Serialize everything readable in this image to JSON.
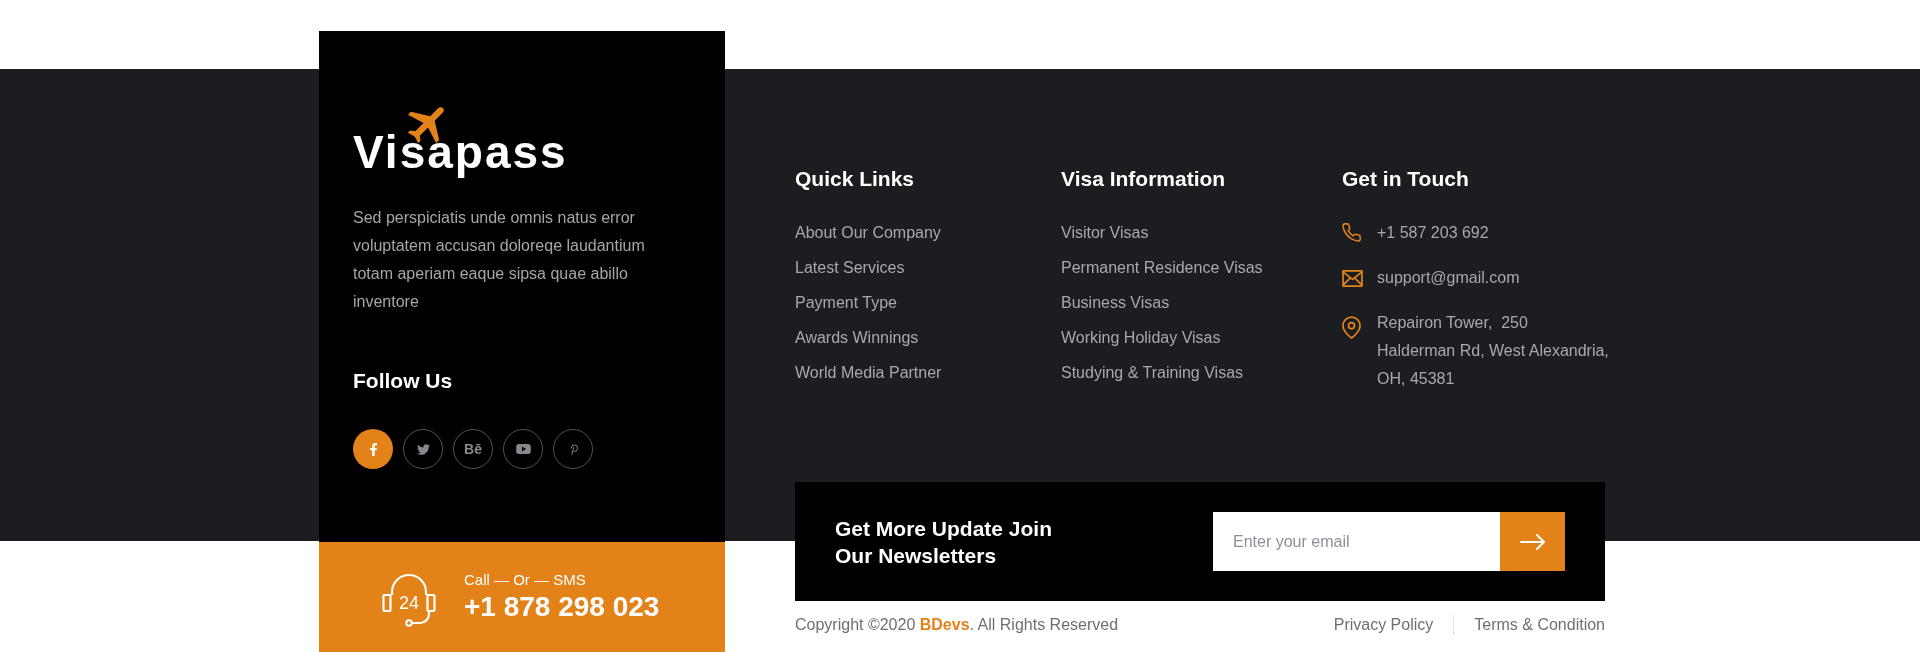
{
  "brand": {
    "name": "Visapass",
    "about": "Sed perspiciatis unde omnis natus error voluptatem accusan doloreqe laudantium totam aperiam eaque sipsa quae abillo inventore"
  },
  "follow": {
    "title": "Follow Us",
    "links": [
      {
        "kind": "facebook",
        "active": true
      },
      {
        "kind": "twitter",
        "active": false
      },
      {
        "kind": "behance",
        "glyph": "Bē",
        "active": false
      },
      {
        "kind": "youtube",
        "active": false
      },
      {
        "kind": "pinterest",
        "active": false
      }
    ]
  },
  "call_box": {
    "icon_text": "24",
    "caption": "Call — Or — SMS",
    "phone": "+1 878 298 023"
  },
  "columns": [
    {
      "title": "Quick Links",
      "links": [
        "About Our Company",
        "Latest Services",
        "Payment Type",
        "Awards Winnings",
        "World Media Partner"
      ]
    },
    {
      "title": "Visa Information",
      "links": [
        "Visitor Visas",
        "Permanent Residence Visas",
        "Business Visas",
        "Working Holiday Visas",
        "Studying & Training Visas"
      ]
    }
  ],
  "contact": {
    "title": "Get in Touch",
    "items": [
      {
        "kind": "phone",
        "lines": [
          "+1 587 203 692"
        ]
      },
      {
        "kind": "email",
        "lines": [
          "support@gmail.com"
        ]
      },
      {
        "kind": "address",
        "lines": [
          "Repairon Tower,  250",
          "Halderman Rd, West Alexandria,",
          "OH, 45381"
        ]
      }
    ]
  },
  "newsletter": {
    "title": "Get More Update Join Our Newsletters",
    "placeholder": "Enter your email"
  },
  "bottom": {
    "copyright": "Copyright ©2020 **BDevs**. All Rights Reserved",
    "links": [
      "Privacy Policy",
      "Terms & Condition"
    ]
  }
}
